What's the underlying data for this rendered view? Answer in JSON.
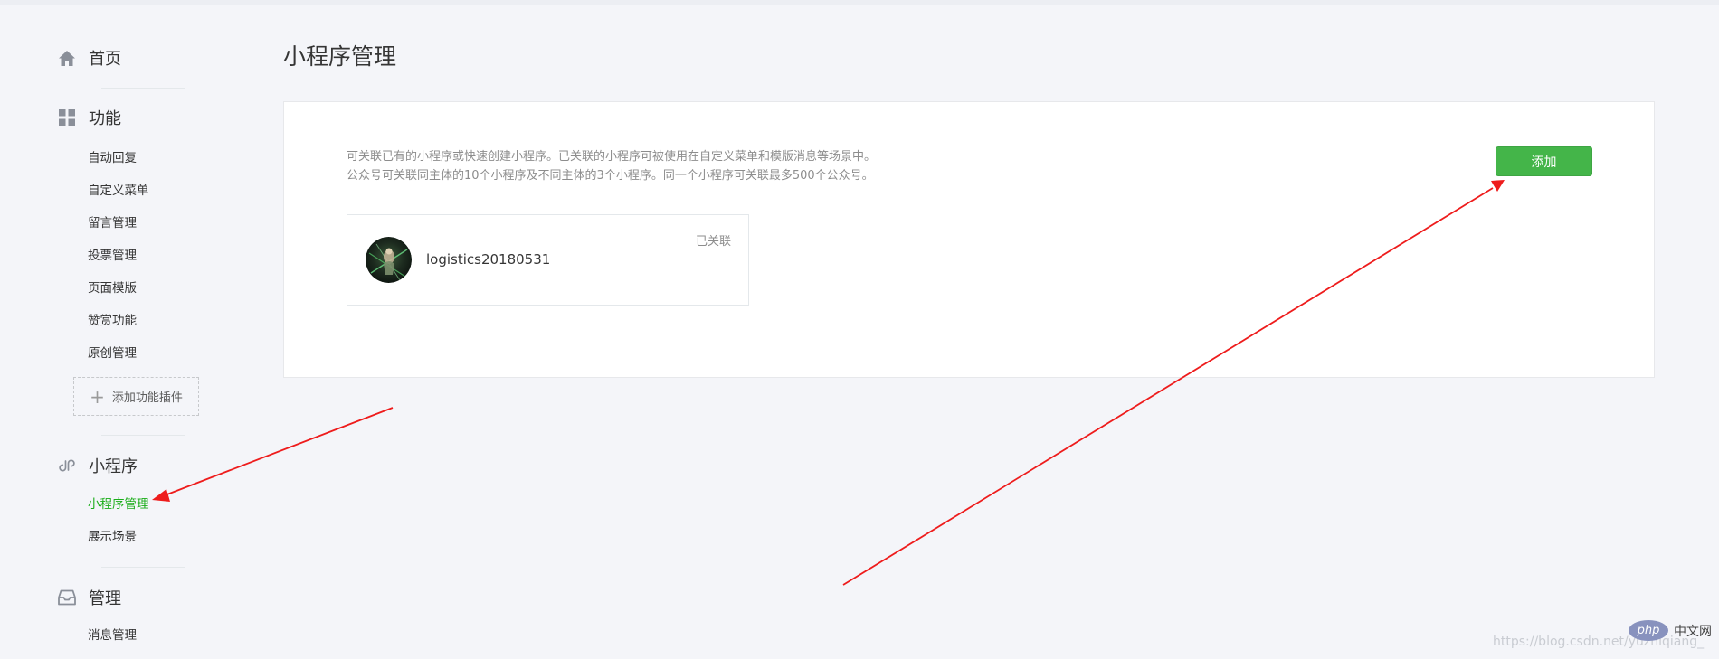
{
  "sidebar": {
    "home_label": "首页",
    "function_label": "功能",
    "function_items": [
      "自动回复",
      "自定义菜单",
      "留言管理",
      "投票管理",
      "页面模版",
      "赞赏功能",
      "原创管理"
    ],
    "add_plugin_label": "添加功能插件",
    "miniprogram_label": "小程序",
    "miniprogram_items": [
      "小程序管理",
      "展示场景"
    ],
    "manage_label": "管理",
    "manage_items": [
      "消息管理"
    ]
  },
  "main": {
    "title": "小程序管理",
    "description_line1": "可关联已有的小程序或快速创建小程序。已关联的小程序可被使用在自定义菜单和模版消息等场景中。",
    "description_line2": "公众号可关联同主体的10个小程序及不同主体的3个小程序。同一个小程序可关联最多500个公众号。",
    "add_button_label": "添加",
    "linked_miniprogram": {
      "name": "logistics20180531",
      "status": "已关联"
    }
  },
  "overlay": {
    "watermark": "https://blog.csdn.net/yuzhiqiang_",
    "php_logo": "php",
    "php_cn": "中文网",
    "arrow_color": "#ee1c1c"
  },
  "theme": {
    "accent_green": "#44b549",
    "active_nav_green": "#1aad19",
    "background": "#f4f5f9"
  }
}
